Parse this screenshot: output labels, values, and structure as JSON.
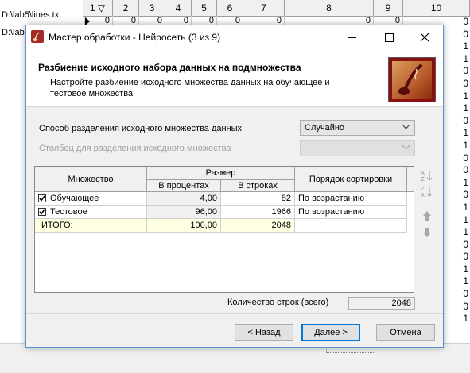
{
  "background": {
    "paths": [
      "D:\\lab5\\lines.txt",
      "D:\\lab5\\"
    ],
    "grid_columns": [
      "1",
      "2",
      "3",
      "4",
      "5",
      "6",
      "7",
      "8",
      "9",
      "10"
    ],
    "row0_values": [
      "0",
      "0",
      "0",
      "0",
      "0",
      "0",
      "0",
      "0",
      "0"
    ],
    "right_column_values": [
      "0",
      "0",
      "1",
      "1",
      "0",
      "0",
      "1",
      "1",
      "0",
      "1",
      "1",
      "0",
      "0",
      "1",
      "0",
      "1",
      "1",
      "1",
      "0",
      "0",
      "1",
      "1",
      "0",
      "0",
      "1"
    ]
  },
  "dialog": {
    "title": "Мастер обработки - Нейросеть (3 из 9)",
    "header_title": "Разбиение исходного набора данных на подмножества",
    "header_desc": "Настройте разбиение исходного множества данных на обучающее и тестовое множества",
    "split_method_label": "Способ разделения исходного множества данных",
    "split_method_value": "Случайно",
    "split_column_label": "Столбец для разделения исходного множества",
    "split_column_value": "",
    "table": {
      "col_set": "Множество",
      "col_size": "Размер",
      "col_percent": "В процентах",
      "col_rows": "В строках",
      "col_sort": "Порядок сортировки",
      "rows": [
        {
          "name": "Обучающее",
          "checked": true,
          "percent": "4,00",
          "rows": "82",
          "sort": "По возрастанию"
        },
        {
          "name": "Тестовое",
          "checked": true,
          "percent": "96,00",
          "rows": "1966",
          "sort": "По возрастанию"
        }
      ],
      "total": {
        "name": "ИТОГО:",
        "percent": "100,00",
        "rows": "2048",
        "sort": ""
      }
    },
    "count_label": "Количество строк (всего)",
    "count_value": "2048",
    "buttons": {
      "back": "< Назад",
      "next": "Далее >",
      "cancel": "Отмена"
    },
    "colors": {
      "accent": "#0078d7",
      "logo": "#8a1010",
      "total_row": "#ffffe1"
    }
  }
}
